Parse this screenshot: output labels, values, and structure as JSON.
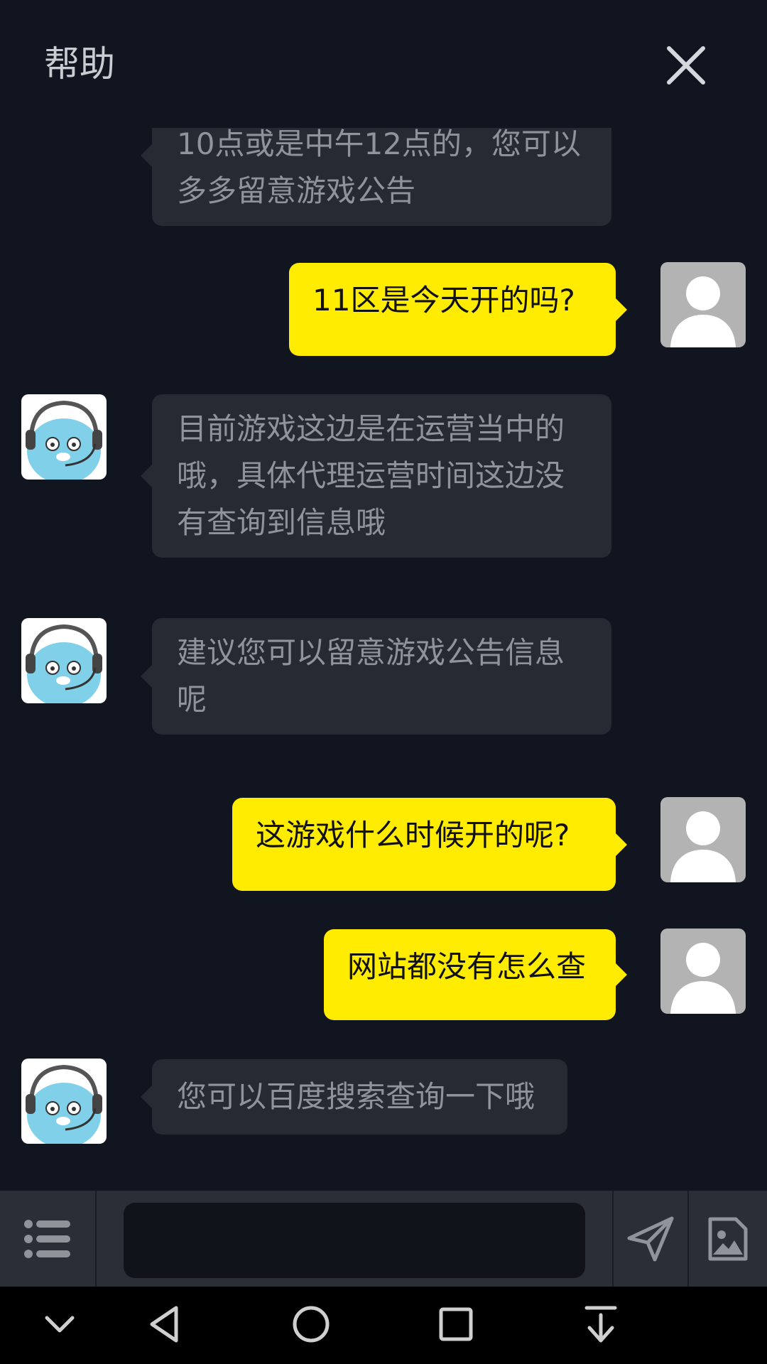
{
  "header": {
    "title": "帮助",
    "close_icon": "close-icon"
  },
  "messages": [
    {
      "from": "agent",
      "text": "10点或是中午12点的，您可以多多留意游戏公告"
    },
    {
      "from": "user",
      "text": "11区是今天开的吗?"
    },
    {
      "from": "agent",
      "text": "目前游戏这边是在运营当中的哦，具体代理运营时间这边没有查询到信息哦"
    },
    {
      "from": "agent",
      "text": "建议您可以留意游戏公告信息呢"
    },
    {
      "from": "user",
      "text": "这游戏什么时候开的呢?"
    },
    {
      "from": "user",
      "text": "网站都没有怎么查"
    },
    {
      "from": "agent",
      "text": "您可以百度搜索查询一下哦"
    }
  ],
  "input_bar": {
    "menu_icon": "list-menu-icon",
    "input_value": "",
    "input_placeholder": "",
    "send_icon": "send-icon",
    "image_icon": "image-icon"
  },
  "nav_bar": {
    "icons": [
      "chevron-down-icon",
      "back-triangle-icon",
      "home-circle-icon",
      "recents-square-icon",
      "pull-down-icon"
    ]
  },
  "colors": {
    "background": "#11151f",
    "agent_bubble": "#262a33",
    "agent_text": "#8f949b",
    "user_bubble": "#ffec00",
    "user_text": "#111111",
    "input_bar": "#2a2e37"
  }
}
